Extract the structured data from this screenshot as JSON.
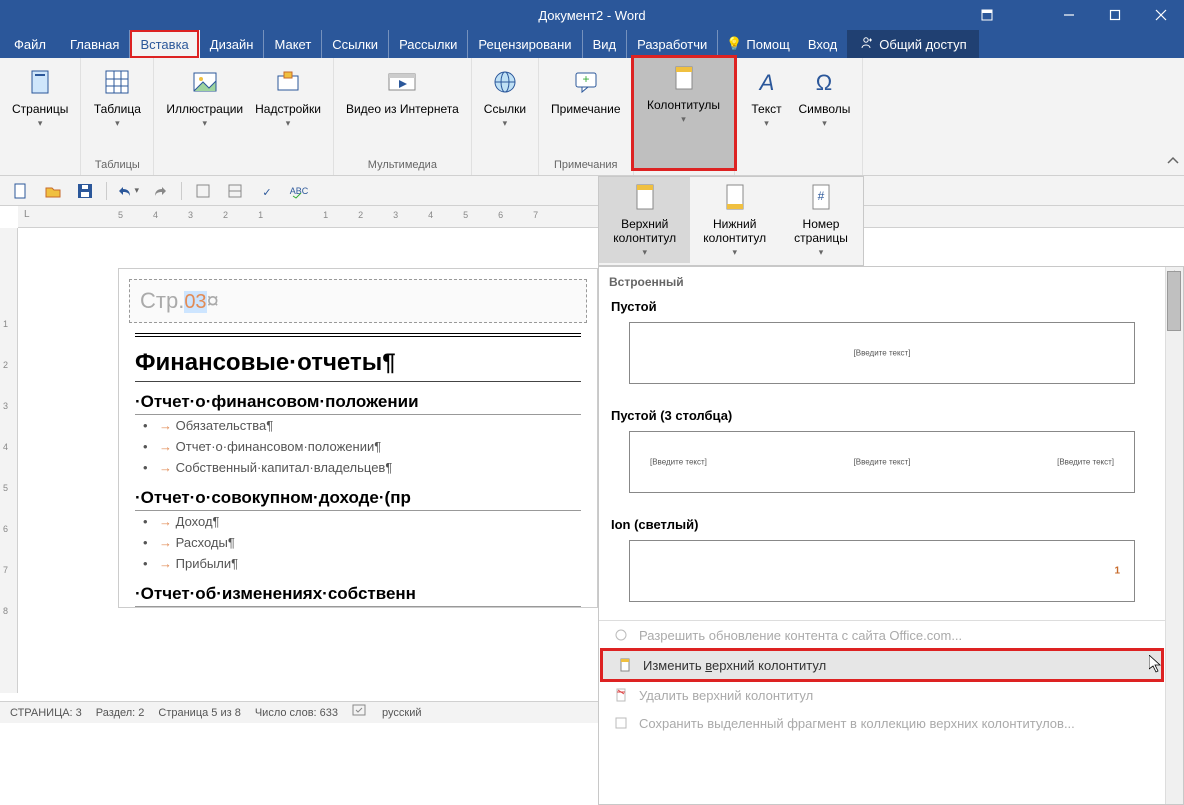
{
  "title": "Документ2 - Word",
  "tabs": {
    "file": "Файл",
    "items": [
      "Главная",
      "Вставка",
      "Дизайн",
      "Макет",
      "Ссылки",
      "Рассылки",
      "Рецензировани",
      "Вид",
      "Разработчи"
    ],
    "active_index": 1,
    "help_label": "Помощ",
    "signin": "Вход",
    "share": "Общий доступ"
  },
  "ribbon": {
    "pages": {
      "label": "Страницы"
    },
    "tables": {
      "btn": "Таблица",
      "group": "Таблицы"
    },
    "illustrations": {
      "btn": "Иллюстрации"
    },
    "addins": {
      "btn": "Надстройки"
    },
    "media": {
      "btn": "Видео из Интернета",
      "group": "Мультимедиа"
    },
    "links": {
      "btn": "Ссылки"
    },
    "comments": {
      "btn": "Примечание",
      "group": "Примечания"
    },
    "headerfooter": {
      "btn": "Колонтитулы"
    },
    "text": {
      "btn": "Текст"
    },
    "symbols": {
      "btn": "Символы"
    }
  },
  "subgallery": {
    "header_top": "Верхний колонтитул",
    "header_bottom": "Нижний колонтитул",
    "page_number": "Номер страницы"
  },
  "ruler_h": [
    "5",
    "4",
    "3",
    "2",
    "1",
    "",
    "1",
    "2",
    "3",
    "4",
    "5",
    "6",
    "7"
  ],
  "ruler_v": [
    "",
    "1",
    "2",
    "3",
    "4",
    "5",
    "6",
    "7",
    "8"
  ],
  "page": {
    "header_prefix": "Стр.",
    "header_num": "03",
    "header_mark": "¤",
    "h1": "Финансовые·отчеты¶",
    "sec1": "Отчет·о·финансовом·положении",
    "sec1_items": [
      "Обязательства¶",
      "Отчет·о·финансовом·положении¶",
      "Собственный·капитал·владельцев¶"
    ],
    "sec2": "Отчет·о·совокупном·доходе·(пр",
    "sec2_items": [
      "Доход¶",
      "Расходы¶",
      "Прибыли¶"
    ],
    "sec3": "Отчет·об·изменениях·собственн"
  },
  "status": {
    "page": "СТРАНИЦА: 3",
    "section": "Раздел: 2",
    "pageof": "Страница 5 из 8",
    "words": "Число слов: 633",
    "lang": "русский"
  },
  "gallery": {
    "builtin": "Встроенный",
    "blank": "Пустой",
    "blank_ph": "[Введите текст]",
    "blank3": "Пустой (3 столбца)",
    "ion": "Ion (светлый)",
    "ion_num": "1",
    "menu_office": "Разрешить обновление контента с сайта Office.com...",
    "menu_edit_pre": "Изменить ",
    "menu_edit_u": "в",
    "menu_edit_post": "ерхний колонтитул",
    "menu_delete": "Удалить верхний колонтитул",
    "menu_save": "Сохранить выделенный фрагмент в коллекцию верхних колонтитулов..."
  }
}
